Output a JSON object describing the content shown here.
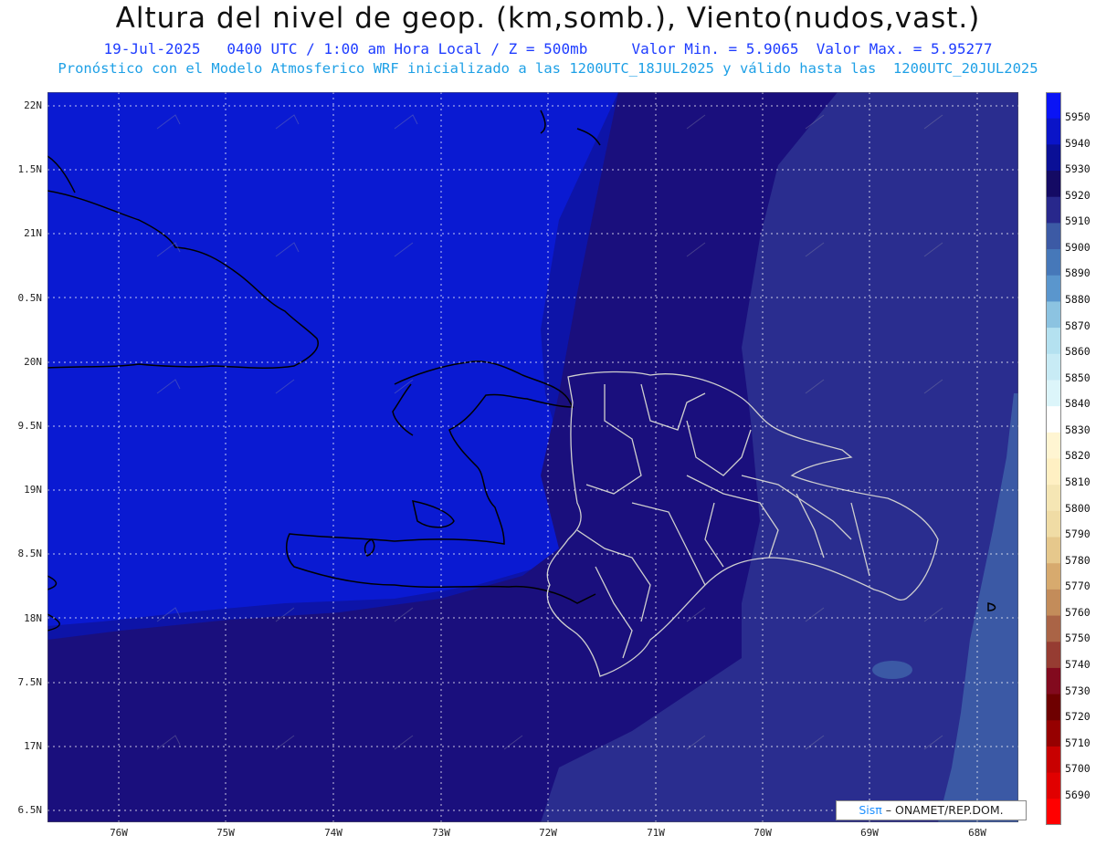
{
  "header": {
    "title": "Altura del nivel de geop. (km,somb.), Viento(nudos,vast.)",
    "line1": "19-Jul-2025   0400 UTC / 1:00 am Hora Local / Z = 500mb     Valor Min. = 5.9065  Valor Max. = 5.95277",
    "line2": "Pronóstico con el Modelo Atmosferico WRF inicializado a las 1200UTC_18JUL2025 y válido hasta las  1200UTC_20JUL2025"
  },
  "axes": {
    "lat_labels": [
      "22N",
      "1.5N",
      "21N",
      "0.5N",
      "20N",
      "9.5N",
      "19N",
      "8.5N",
      "18N",
      "7.5N",
      "17N",
      "6.5N"
    ],
    "lon_labels": [
      "76W",
      "75W",
      "74W",
      "73W",
      "72W",
      "71W",
      "70W",
      "69W",
      "68W"
    ]
  },
  "colorbar": {
    "labels": [
      "5950",
      "5940",
      "5930",
      "5920",
      "5910",
      "5900",
      "5890",
      "5880",
      "5870",
      "5860",
      "5850",
      "5840",
      "5830",
      "5820",
      "5810",
      "5800",
      "5790",
      "5780",
      "5770",
      "5760",
      "5750",
      "5740",
      "5730",
      "5720",
      "5710",
      "5700",
      "5690"
    ],
    "colors": [
      "#0a14f5",
      "#0a14c8",
      "#0a0f96",
      "#140a64",
      "#28288c",
      "#3c5aa5",
      "#4678b9",
      "#5a96cd",
      "#8cc3e1",
      "#b4e1f0",
      "#c8ebf5",
      "#dcf5fa",
      "#ffffff",
      "#fff5d2",
      "#fff0c3",
      "#f5e6b4",
      "#f0dca5",
      "#e6c88c",
      "#d7aa6e",
      "#c38c5a",
      "#aa6446",
      "#963c32",
      "#820a1e",
      "#6e0000",
      "#960000",
      "#c80000",
      "#e10000",
      "#ff0000"
    ]
  },
  "map": {
    "colors": {
      "band_5940": "#0a1ad2",
      "band_5930": "#0d14a8",
      "band_5920": "#1a0f7d",
      "band_5910": "#2a2d8f",
      "band_5900": "#3b59a5",
      "coastline": "#000000",
      "provinces": "#cfcfcf"
    }
  },
  "credit": {
    "brand": "Sisπ",
    "text": " – ONAMET/REP.DOM."
  }
}
